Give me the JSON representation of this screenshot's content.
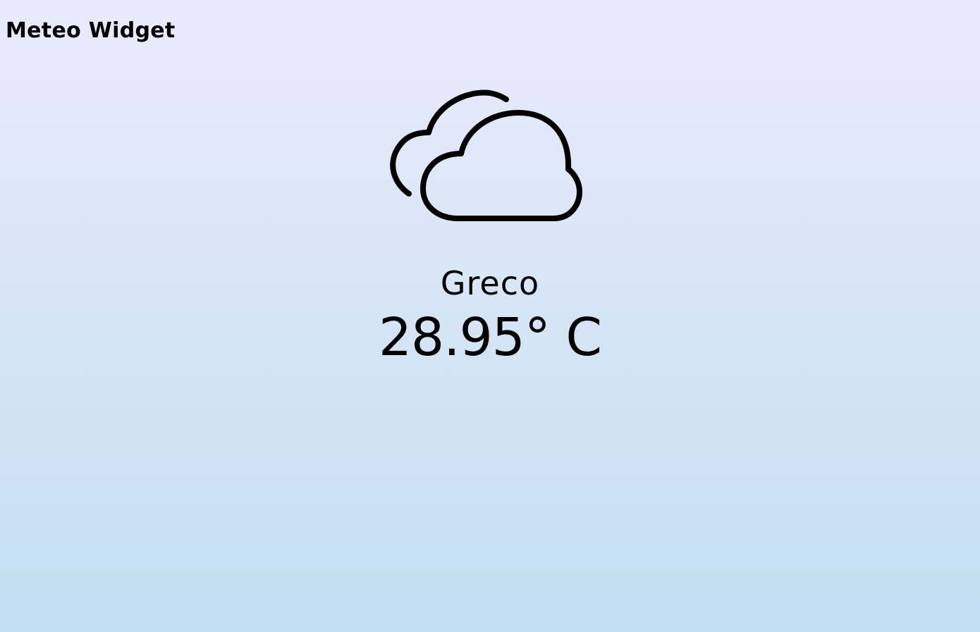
{
  "header": {
    "title": "Meteo Widget"
  },
  "weather": {
    "icon": "cloudy-icon",
    "location": "Greco",
    "temperature": "28.95° C"
  },
  "colors": {
    "background_top": "#e9ebfc",
    "background_bottom": "#c3dff2",
    "text": "#000000"
  }
}
